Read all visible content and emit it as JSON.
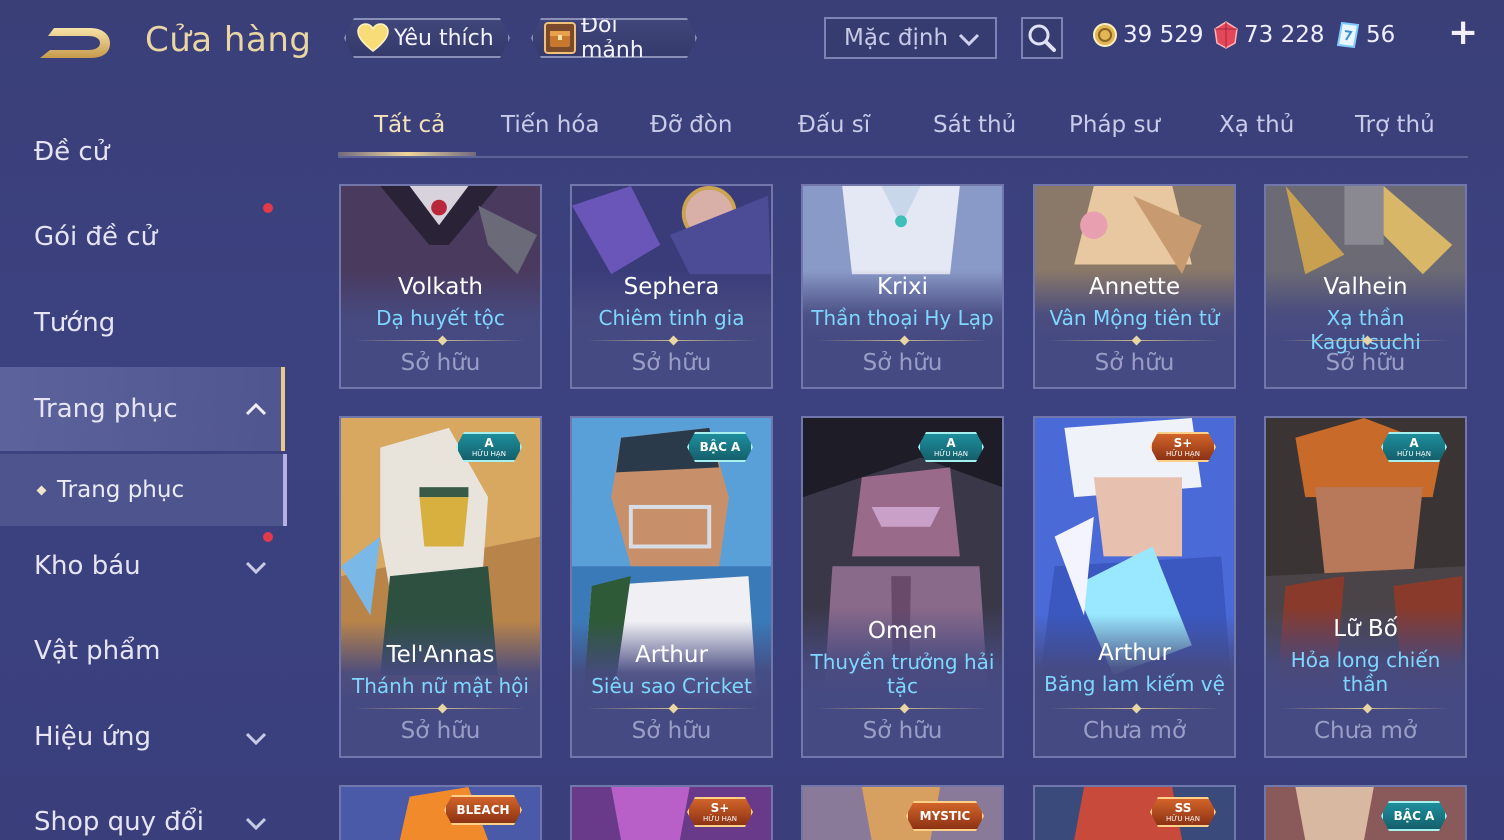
{
  "header": {
    "title": "Cửa hàng",
    "favorites_label": "Yêu thích",
    "exchange_label": "Đổi mảnh",
    "sort_value": "Mặc định",
    "currencies": [
      {
        "name": "gold",
        "value": "39 529",
        "color": "#e9c46a"
      },
      {
        "name": "ruby",
        "value": "73 228",
        "color": "#e2485a"
      },
      {
        "name": "voucher",
        "value": "56",
        "color": "#7fc9ff"
      }
    ],
    "add_label": "+"
  },
  "sidebar": {
    "items": [
      {
        "label": "Đề cử"
      },
      {
        "label": "Gói đề cử"
      },
      {
        "label": "Tướng"
      },
      {
        "label": "Trang phục"
      },
      {
        "label": "Kho báu"
      },
      {
        "label": "Vật phẩm"
      },
      {
        "label": "Hiệu ứng"
      },
      {
        "label": "Shop quy đổi"
      }
    ],
    "sub_label": "Trang phục"
  },
  "tabs": [
    "Tất cả",
    "Tiến hóa",
    "Đỡ đòn",
    "Đấu sĩ",
    "Sát thủ",
    "Pháp sư",
    "Xạ thủ",
    "Trợ thủ"
  ],
  "cards_row1": [
    {
      "hero": "Volkath",
      "skin": "Dạ huyết tộc",
      "status": "Sở hữu"
    },
    {
      "hero": "Sephera",
      "skin": "Chiêm tinh gia",
      "status": "Sở hữu"
    },
    {
      "hero": "Krixi",
      "skin": "Thần thoại Hy Lạp",
      "status": "Sở hữu"
    },
    {
      "hero": "Annette",
      "skin": "Vân Mộng tiên tử",
      "status": "Sở hữu"
    },
    {
      "hero": "Valhein",
      "skin": "Xạ thần Kagutsuchi",
      "status": "Sở hữu"
    }
  ],
  "cards_row2": [
    {
      "hero": "Tel'Annas",
      "skin": "Thánh nữ mật hội",
      "status": "Sở hữu",
      "badge": "A",
      "badge_sub": "HỮU HẠN"
    },
    {
      "hero": "Arthur",
      "skin": "Siêu sao Cricket",
      "status": "Sở hữu",
      "badge": "BẬC A",
      "badge_sub": ""
    },
    {
      "hero": "Omen",
      "skin": "Thuyền trưởng hải tặc",
      "status": "Sở hữu",
      "badge": "A",
      "badge_sub": "HỮU HẠN"
    },
    {
      "hero": "Arthur",
      "skin": "Băng lam kiếm vệ",
      "status": "Chưa mở",
      "badge": "S+",
      "badge_sub": "HỮU HẠN"
    },
    {
      "hero": "Lữ Bố",
      "skin": "Hỏa long chiến thần",
      "status": "Chưa mở",
      "badge": "A",
      "badge_sub": "HỮU HẠN"
    }
  ],
  "cards_row3": [
    {
      "badge": "BLEACH",
      "badge_sub": ""
    },
    {
      "badge": "S+",
      "badge_sub": "HỮU HẠN"
    },
    {
      "badge": "MYSTIC",
      "badge_sub": ""
    },
    {
      "badge": "SS",
      "badge_sub": "HỮU HẠN"
    },
    {
      "badge": "BẬC A",
      "badge_sub": ""
    }
  ]
}
